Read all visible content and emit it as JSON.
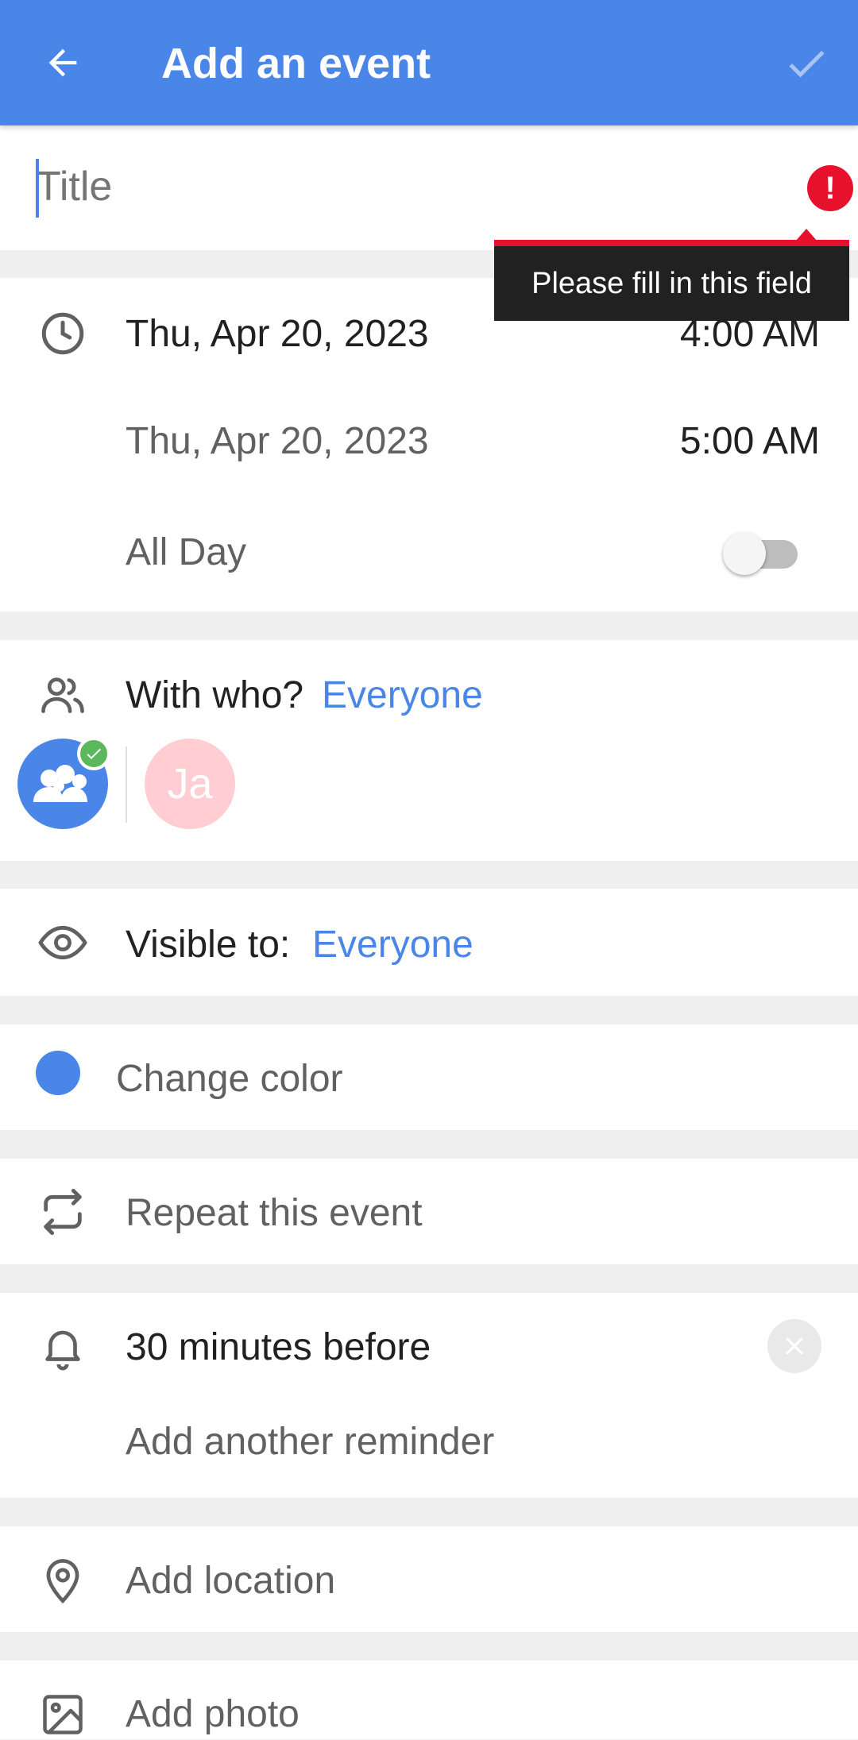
{
  "app_bar": {
    "title": "Add an event",
    "back_icon": "arrow-back-icon",
    "save_icon": "check-icon",
    "color": "#4a86e8"
  },
  "title_field": {
    "placeholder": "Title",
    "value": "",
    "error_tooltip": "Please fill in this field",
    "error_color": "#e8112d"
  },
  "datetime": {
    "start_date": "Thu, Apr 20, 2023",
    "start_time": "4:00 AM",
    "end_date": "Thu, Apr 20, 2023",
    "end_time": "5:00 AM",
    "all_day_label": "All Day",
    "all_day_on": false
  },
  "participants": {
    "label": "With who?",
    "value": "Everyone",
    "avatars": [
      {
        "type": "family-group",
        "selected": true
      },
      {
        "initials": "Ja",
        "color": "#ffcdd2",
        "selected": false
      }
    ]
  },
  "visibility": {
    "label": "Visible to:",
    "value": "Everyone"
  },
  "color": {
    "label": "Change color",
    "value": "#4a86e8"
  },
  "repeat": {
    "label": "Repeat this event"
  },
  "reminders": {
    "items": [
      "30 minutes before"
    ],
    "add_label": "Add another reminder"
  },
  "location": {
    "label": "Add location"
  },
  "photo": {
    "label": "Add photo"
  }
}
